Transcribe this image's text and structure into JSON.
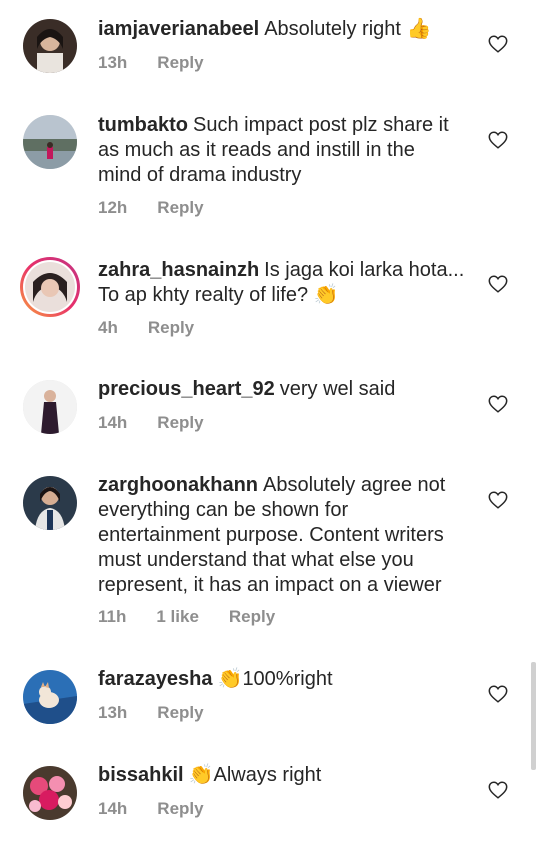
{
  "comments": [
    {
      "user": "iamjaverianabeel",
      "text": "Absolutely right",
      "emoji": "👍",
      "time": "13h",
      "likes": "",
      "reply": "Reply"
    },
    {
      "user": "tumbakto",
      "text": "Such impact post plz share it as much as it reads and instill in the mind of drama industry",
      "emoji": "",
      "time": "12h",
      "likes": "",
      "reply": "Reply"
    },
    {
      "user": "zahra_hasnainzh",
      "text": "Is jaga koi larka hota... To ap khty realty of life?",
      "emoji": "👏",
      "time": "4h",
      "likes": "",
      "reply": "Reply"
    },
    {
      "user": "precious_heart_92",
      "text": "very wel said",
      "emoji": "",
      "time": "14h",
      "likes": "",
      "reply": "Reply"
    },
    {
      "user": "zarghoonakhann",
      "text": "Absolutely agree not everything can be shown for entertainment purpose. Content writers must understand that what else you represent, it has an impact on a viewer",
      "emoji": "",
      "time": "11h",
      "likes": "1 like",
      "reply": "Reply"
    },
    {
      "user": "farazayesha",
      "text": "100%right",
      "emoji": "👏",
      "emoji_first": true,
      "time": "13h",
      "likes": "",
      "reply": "Reply"
    },
    {
      "user": "bissahkil",
      "text": "Always right",
      "emoji": "👏",
      "emoji_first": true,
      "time": "14h",
      "likes": "",
      "reply": "Reply"
    }
  ],
  "icons": {
    "like": "heart-outline-icon"
  }
}
